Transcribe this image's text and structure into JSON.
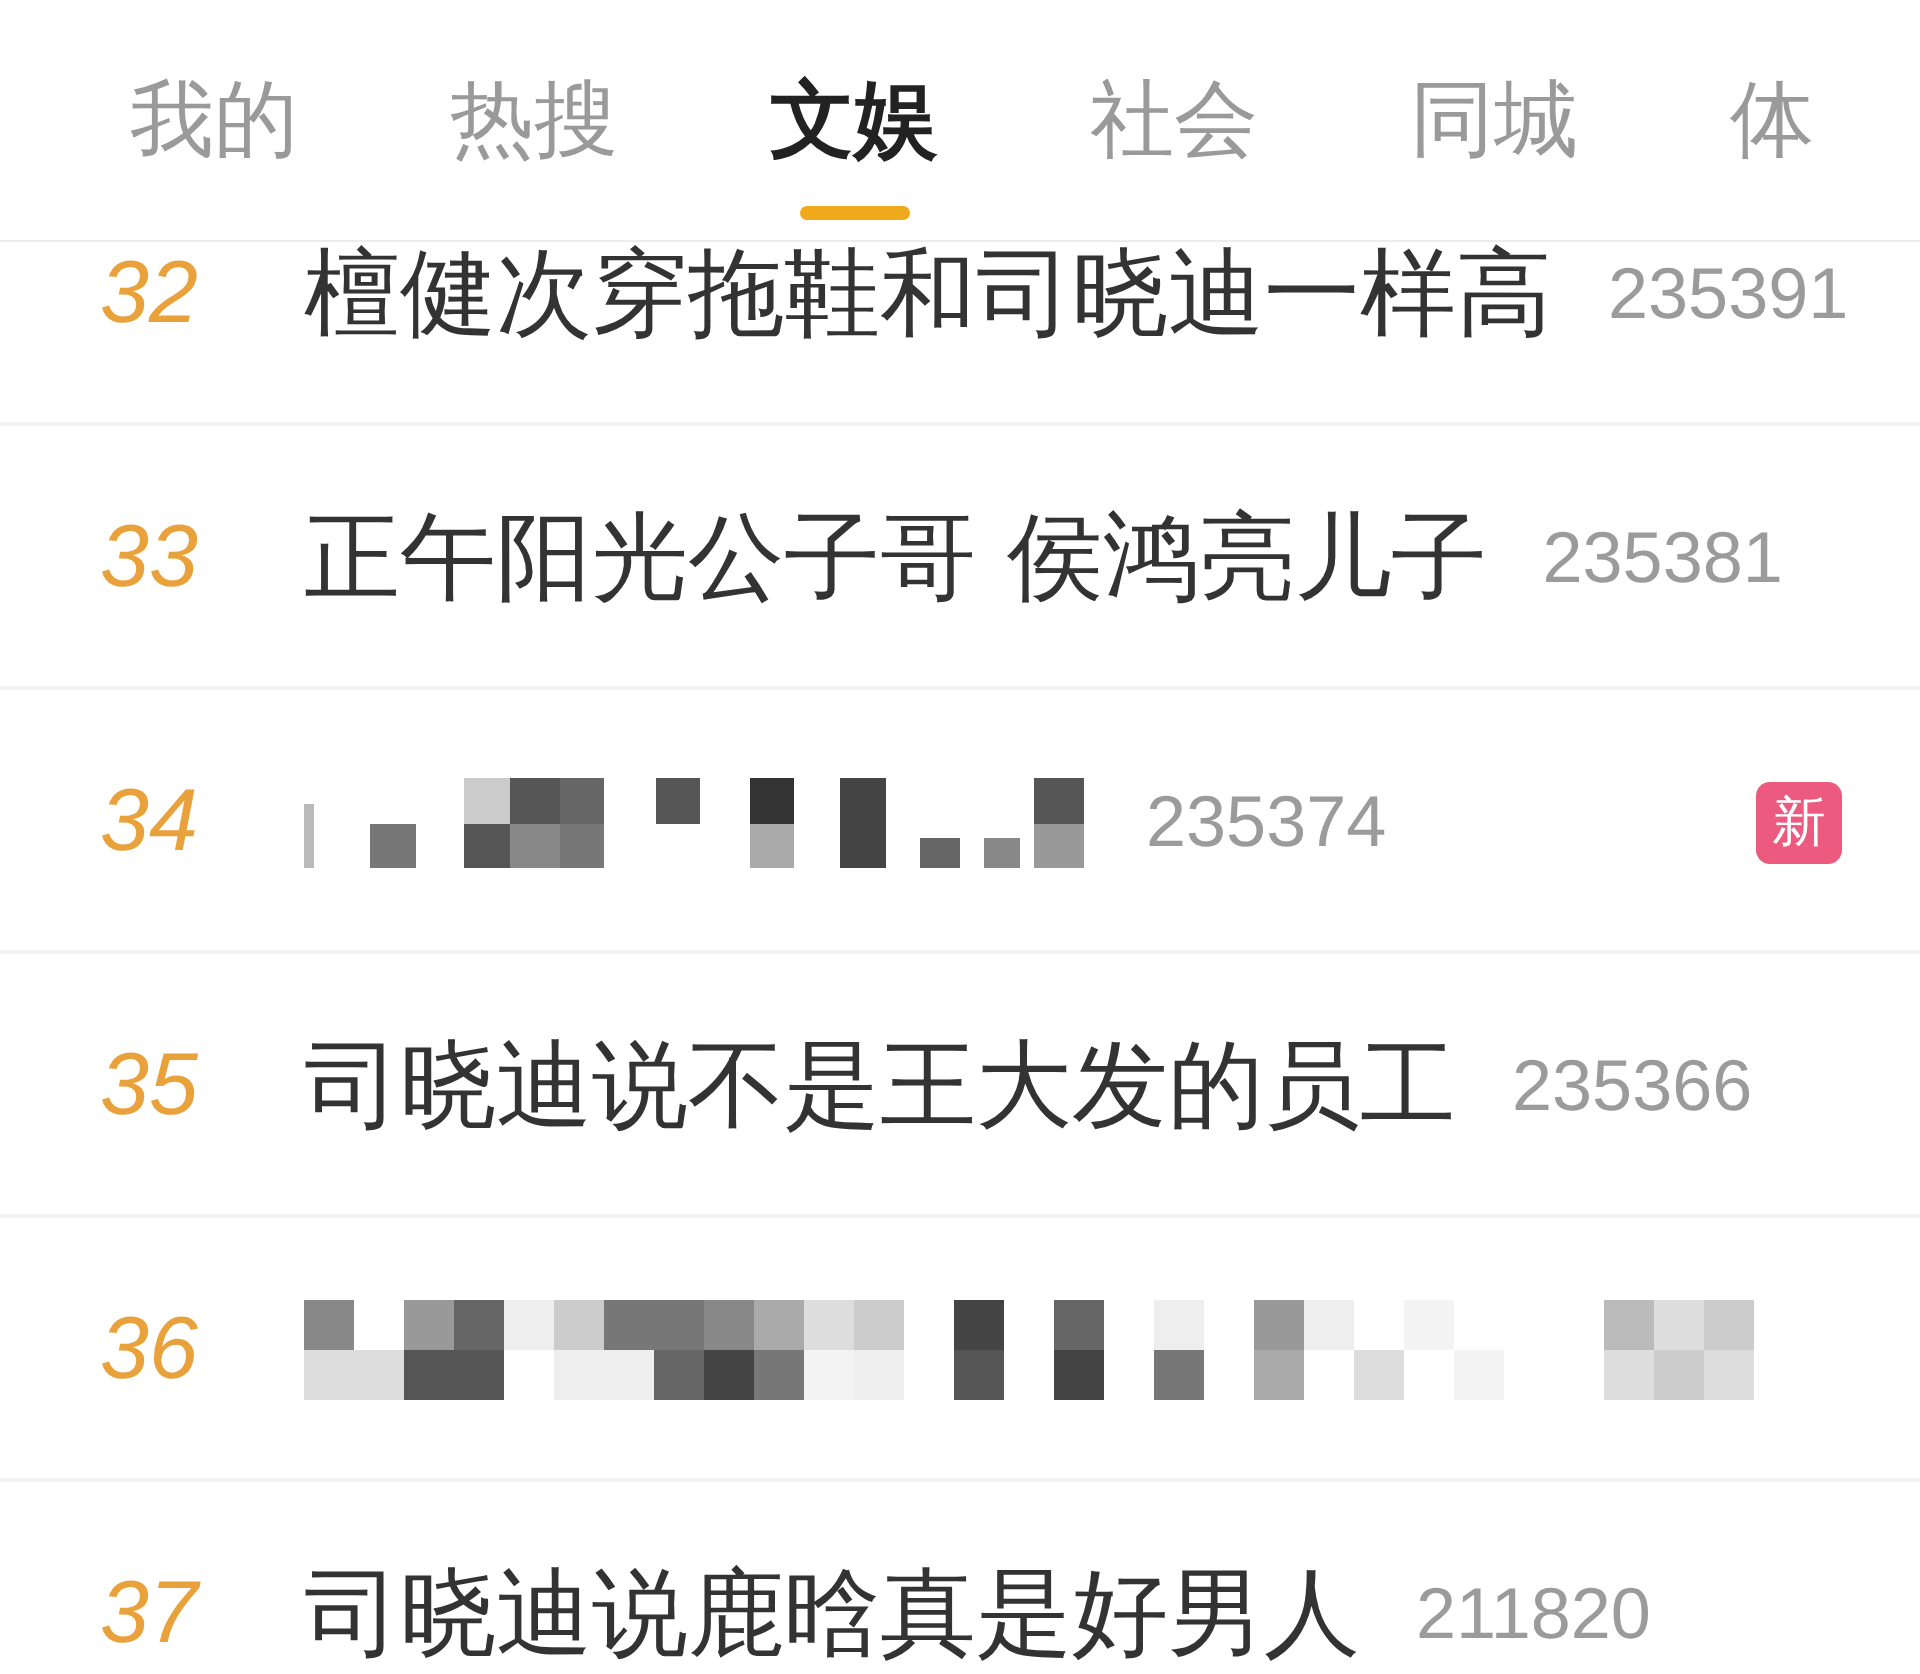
{
  "tabs": [
    {
      "label": "我的",
      "selected": false
    },
    {
      "label": "热搜",
      "selected": false
    },
    {
      "label": "文娱",
      "selected": true
    },
    {
      "label": "社会",
      "selected": false
    },
    {
      "label": "同城",
      "selected": false
    },
    {
      "label": "体",
      "selected": false
    }
  ],
  "hot_list": [
    {
      "rank": "32",
      "kind": "topic",
      "title": "檀健次穿拖鞋和司晓迪一样高",
      "count": "235391"
    },
    {
      "rank": "33",
      "kind": "topic",
      "title": "正午阳光公子哥 侯鸿亮儿子",
      "count": "235381"
    },
    {
      "rank": "34",
      "kind": "pixelated",
      "count": "235374",
      "badge": "新"
    },
    {
      "rank": "35",
      "kind": "topic",
      "title": "司晓迪说不是王大发的员工",
      "count": "235366"
    },
    {
      "rank": "36",
      "kind": "pixelated"
    },
    {
      "rank": "37",
      "kind": "topic",
      "title": "司晓迪说鹿晗真是好男人",
      "count": "211820"
    }
  ]
}
